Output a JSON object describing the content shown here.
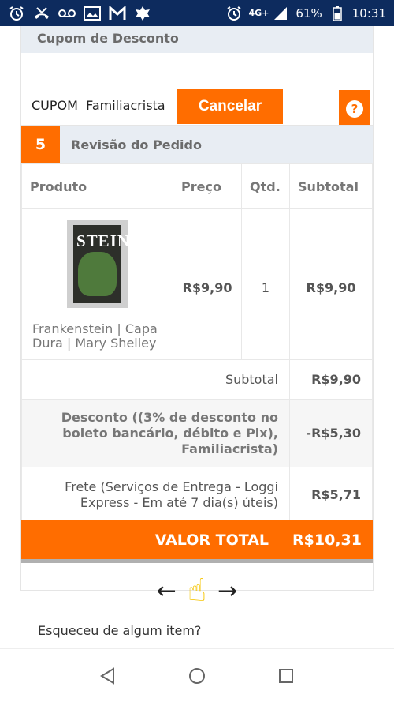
{
  "status_bar": {
    "network": "4G+",
    "battery": "61%",
    "time": "10:31",
    "icons": [
      "alarm-icon",
      "missed-call-icon",
      "voicemail-icon",
      "photo-icon",
      "gmail-icon",
      "avast-icon",
      "alarm-icon",
      "signal-icon",
      "battery-icon"
    ]
  },
  "coupon": {
    "header": "Cupom de Desconto",
    "code_label": "CUPOM  Familiacrista",
    "cancel_button": "Cancelar",
    "help_button": "?"
  },
  "review": {
    "step_number": "5",
    "title": "Revisão do Pedido",
    "columns": [
      "Produto",
      "Preço",
      "Qtd.",
      "Subtotal"
    ],
    "items": [
      {
        "cover_text": "STEIN",
        "name": "Frankenstein | Capa Dura | Mary Shelley",
        "price": "R$9,90",
        "qty": "1",
        "subtotal": "R$9,90"
      }
    ],
    "summary": {
      "subtotal_label": "Subtotal",
      "subtotal_value": "R$9,90",
      "discount_label": "Desconto ((3% de desconto no boleto bancário, débito e Pix), Familiacrista)",
      "discount_value": "-R$5,30",
      "shipping_label": "Frete (Serviços de Entrega - Loggi Express - Em até 7 dia(s) úteis)",
      "shipping_value": "R$5,71"
    },
    "total_label": "VALOR TOTAL",
    "total_value": "R$10,31"
  },
  "scroll_hint": {
    "left_arrow": "←",
    "hand": "☝",
    "right_arrow": "→"
  },
  "forgot_text": "Esqueceu de algum item?",
  "colors": {
    "accent": "#ff6d00",
    "status_bar": "#0d2b5e",
    "header_bg": "#e8edf3"
  }
}
